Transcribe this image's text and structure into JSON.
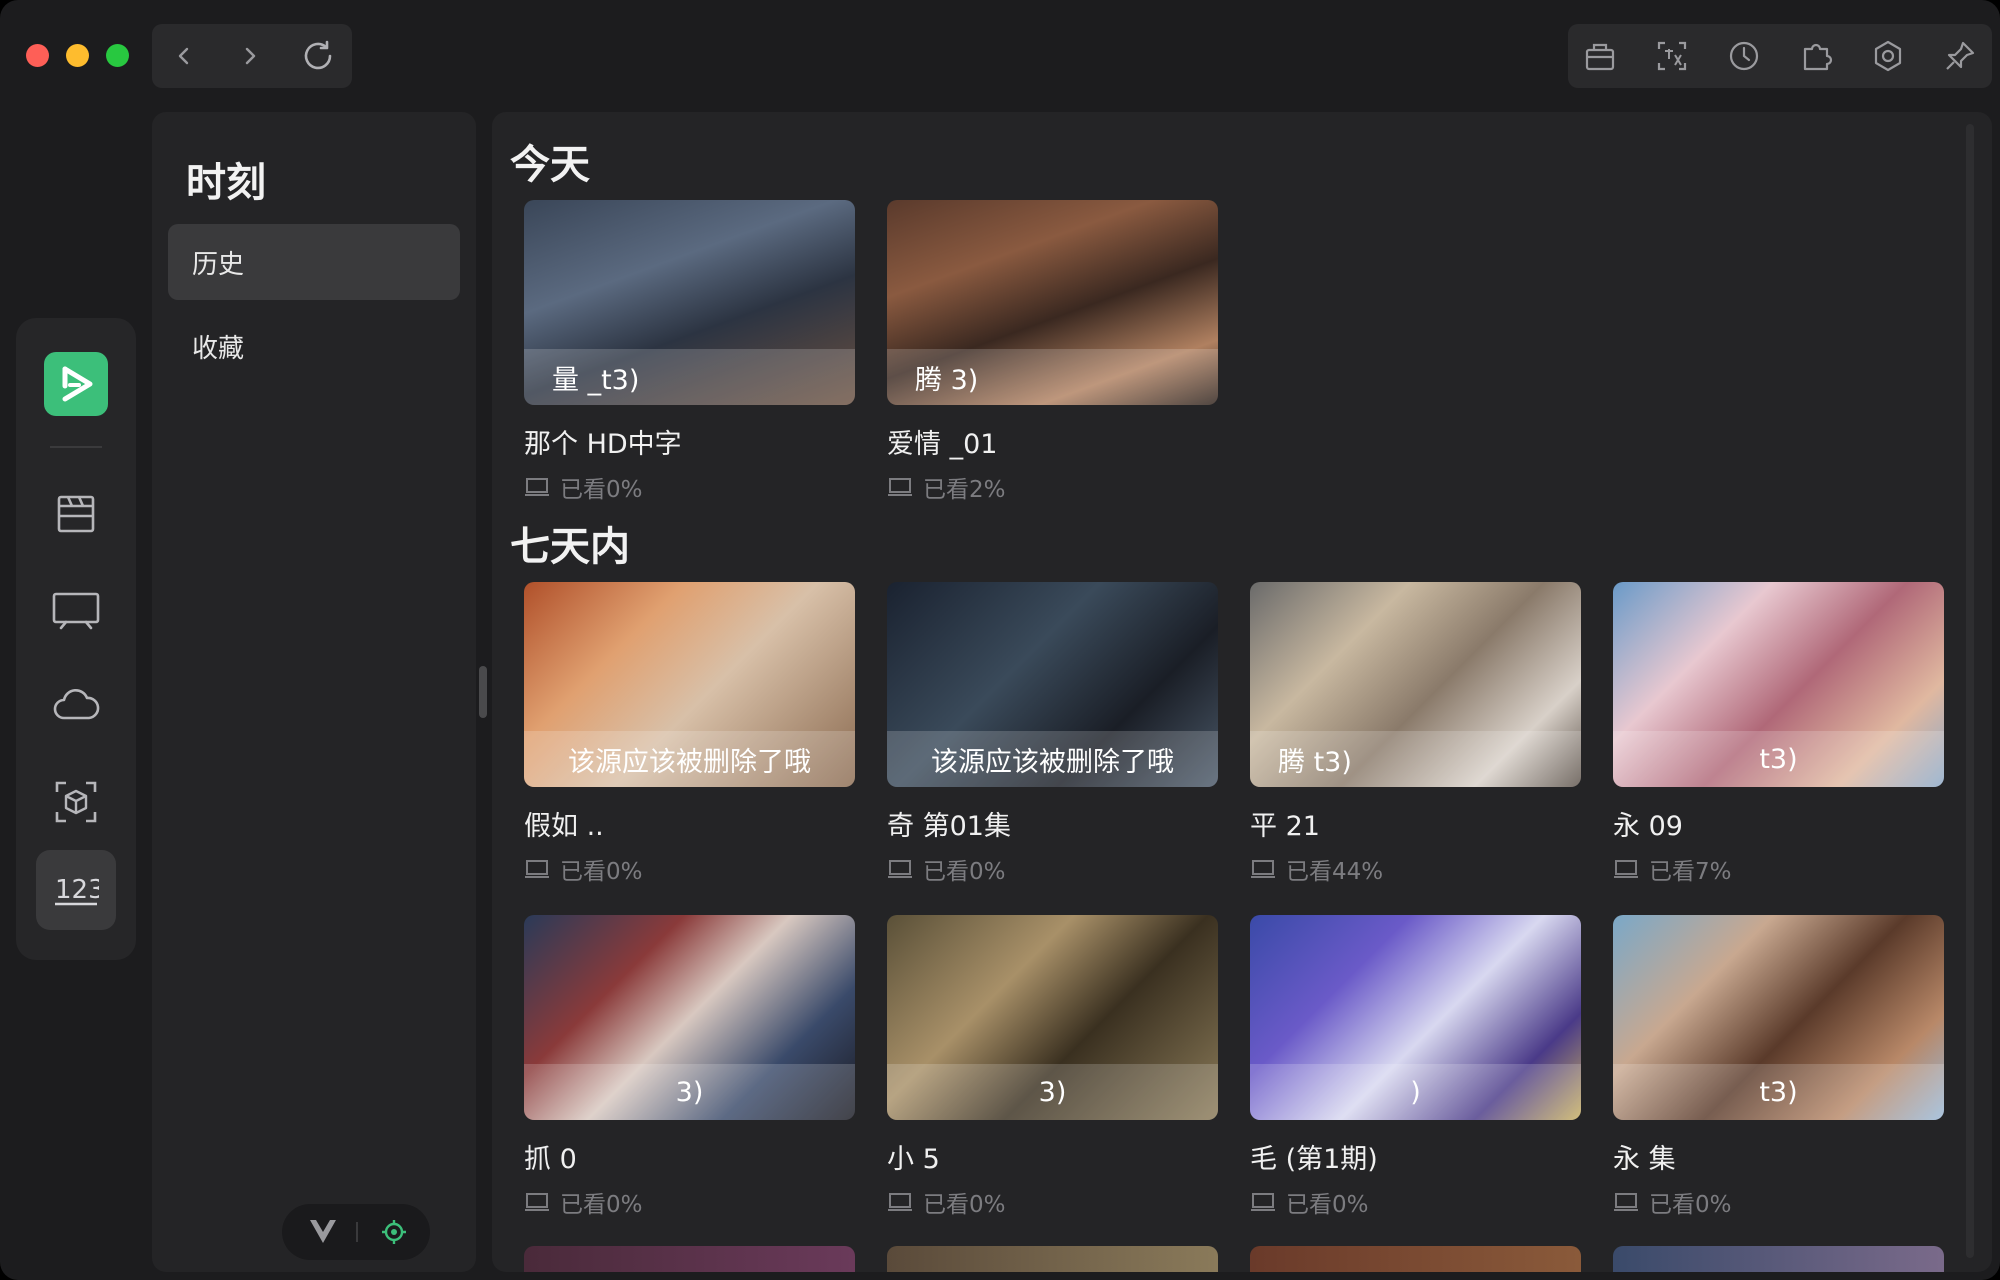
{
  "window": {
    "title_buttons": [
      "close",
      "minimize",
      "zoom"
    ]
  },
  "nav": {
    "back_icon": "chevron-left-icon",
    "forward_icon": "chevron-right-icon",
    "reload_icon": "reload-icon"
  },
  "toolbar": {
    "icons": [
      "gift-icon",
      "scan-translate-icon",
      "history-icon",
      "puzzle-icon",
      "settings-hex-icon",
      "pin-icon"
    ]
  },
  "rail": {
    "items": [
      "app-logo",
      "film-icon",
      "tv-icon",
      "cloud-icon",
      "cube-scan-icon",
      "number-123-icon"
    ],
    "active": "number-123-icon"
  },
  "panel": {
    "title": "时刻",
    "menu": [
      {
        "label": "历史",
        "active": true
      },
      {
        "label": "收藏",
        "active": false
      }
    ]
  },
  "sections": [
    {
      "title": "今天",
      "cards": [
        {
          "overlay": "量                          _t3)",
          "title": "那个                  HD中字",
          "progress": "已看0%"
        },
        {
          "overlay": "腾                                  3)",
          "title": "爱情                                    _01",
          "progress": "已看2%"
        }
      ]
    },
    {
      "title": "七天内",
      "cards": [
        {
          "overlay": "该源应该被删除了哦",
          "title": "假如                               ..",
          "progress": "已看0%"
        },
        {
          "overlay": "该源应该被删除了哦",
          "title": "奇                       第01集",
          "progress": "已看0%"
        },
        {
          "overlay": "腾                              t3)",
          "title": "平                            21",
          "progress": "已看44%"
        },
        {
          "overlay": "                                     t3)",
          "title": "永                               09",
          "progress": "已看7%"
        },
        {
          "overlay": "                                      3)",
          "title": "抓           0",
          "progress": "已看0%"
        },
        {
          "overlay": "                                       3)",
          "title": "小              5",
          "progress": "已看0%"
        },
        {
          "overlay": "                                      )",
          "title": "毛                         (第1期)",
          "progress": "已看0%"
        },
        {
          "overlay": "                                     t3)",
          "title": "永                          集",
          "progress": "已看0%"
        }
      ]
    }
  ],
  "colors": {
    "accent_green": "#3cbf7a",
    "window_bg": "#1c1c1e",
    "panel_bg": "#242426",
    "active_bg": "#3a3a3c"
  }
}
